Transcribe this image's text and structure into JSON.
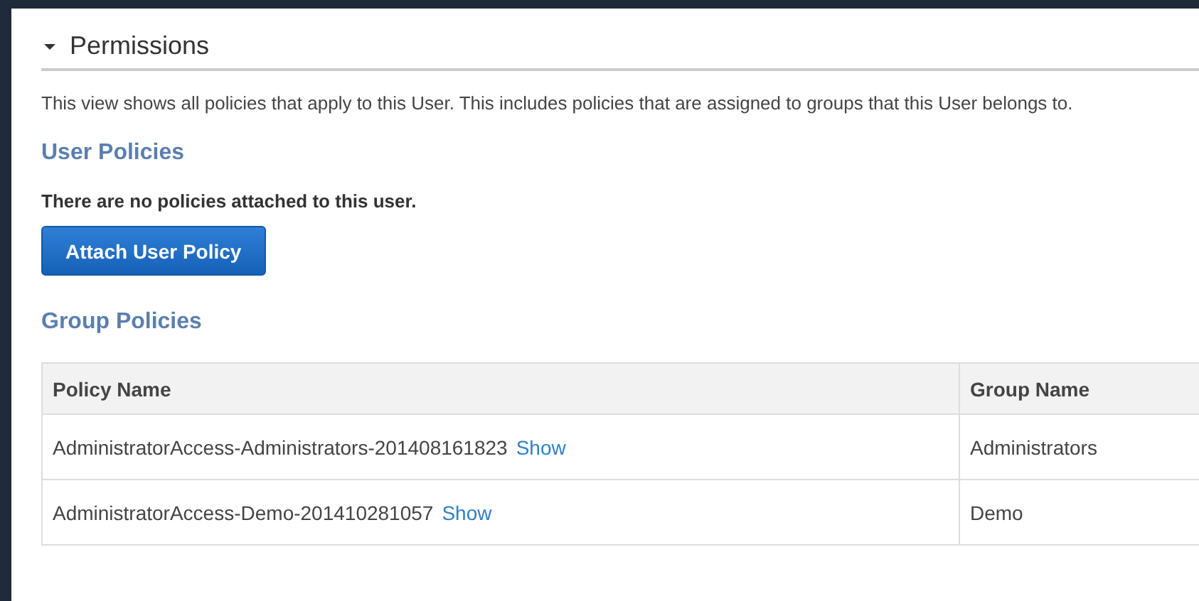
{
  "section": {
    "title": "Permissions",
    "expanded": true
  },
  "description": "This view shows all policies that apply to this User. This includes policies that are assigned to groups that this User belongs to.",
  "user_policies": {
    "heading": "User Policies",
    "empty_message": "There are no policies attached to this user.",
    "button": "Attach User Policy"
  },
  "group_policies": {
    "heading": "Group Policies",
    "table": {
      "columns": [
        "Policy Name",
        "Group Name"
      ],
      "rows": [
        {
          "policy_name": "AdministratorAccess-Administrators-201408161823",
          "link": "Show",
          "group_name": "Administrators"
        },
        {
          "policy_name": "AdministratorAccess-Demo-201410281057",
          "link": "Show",
          "group_name": "Demo"
        }
      ]
    }
  }
}
